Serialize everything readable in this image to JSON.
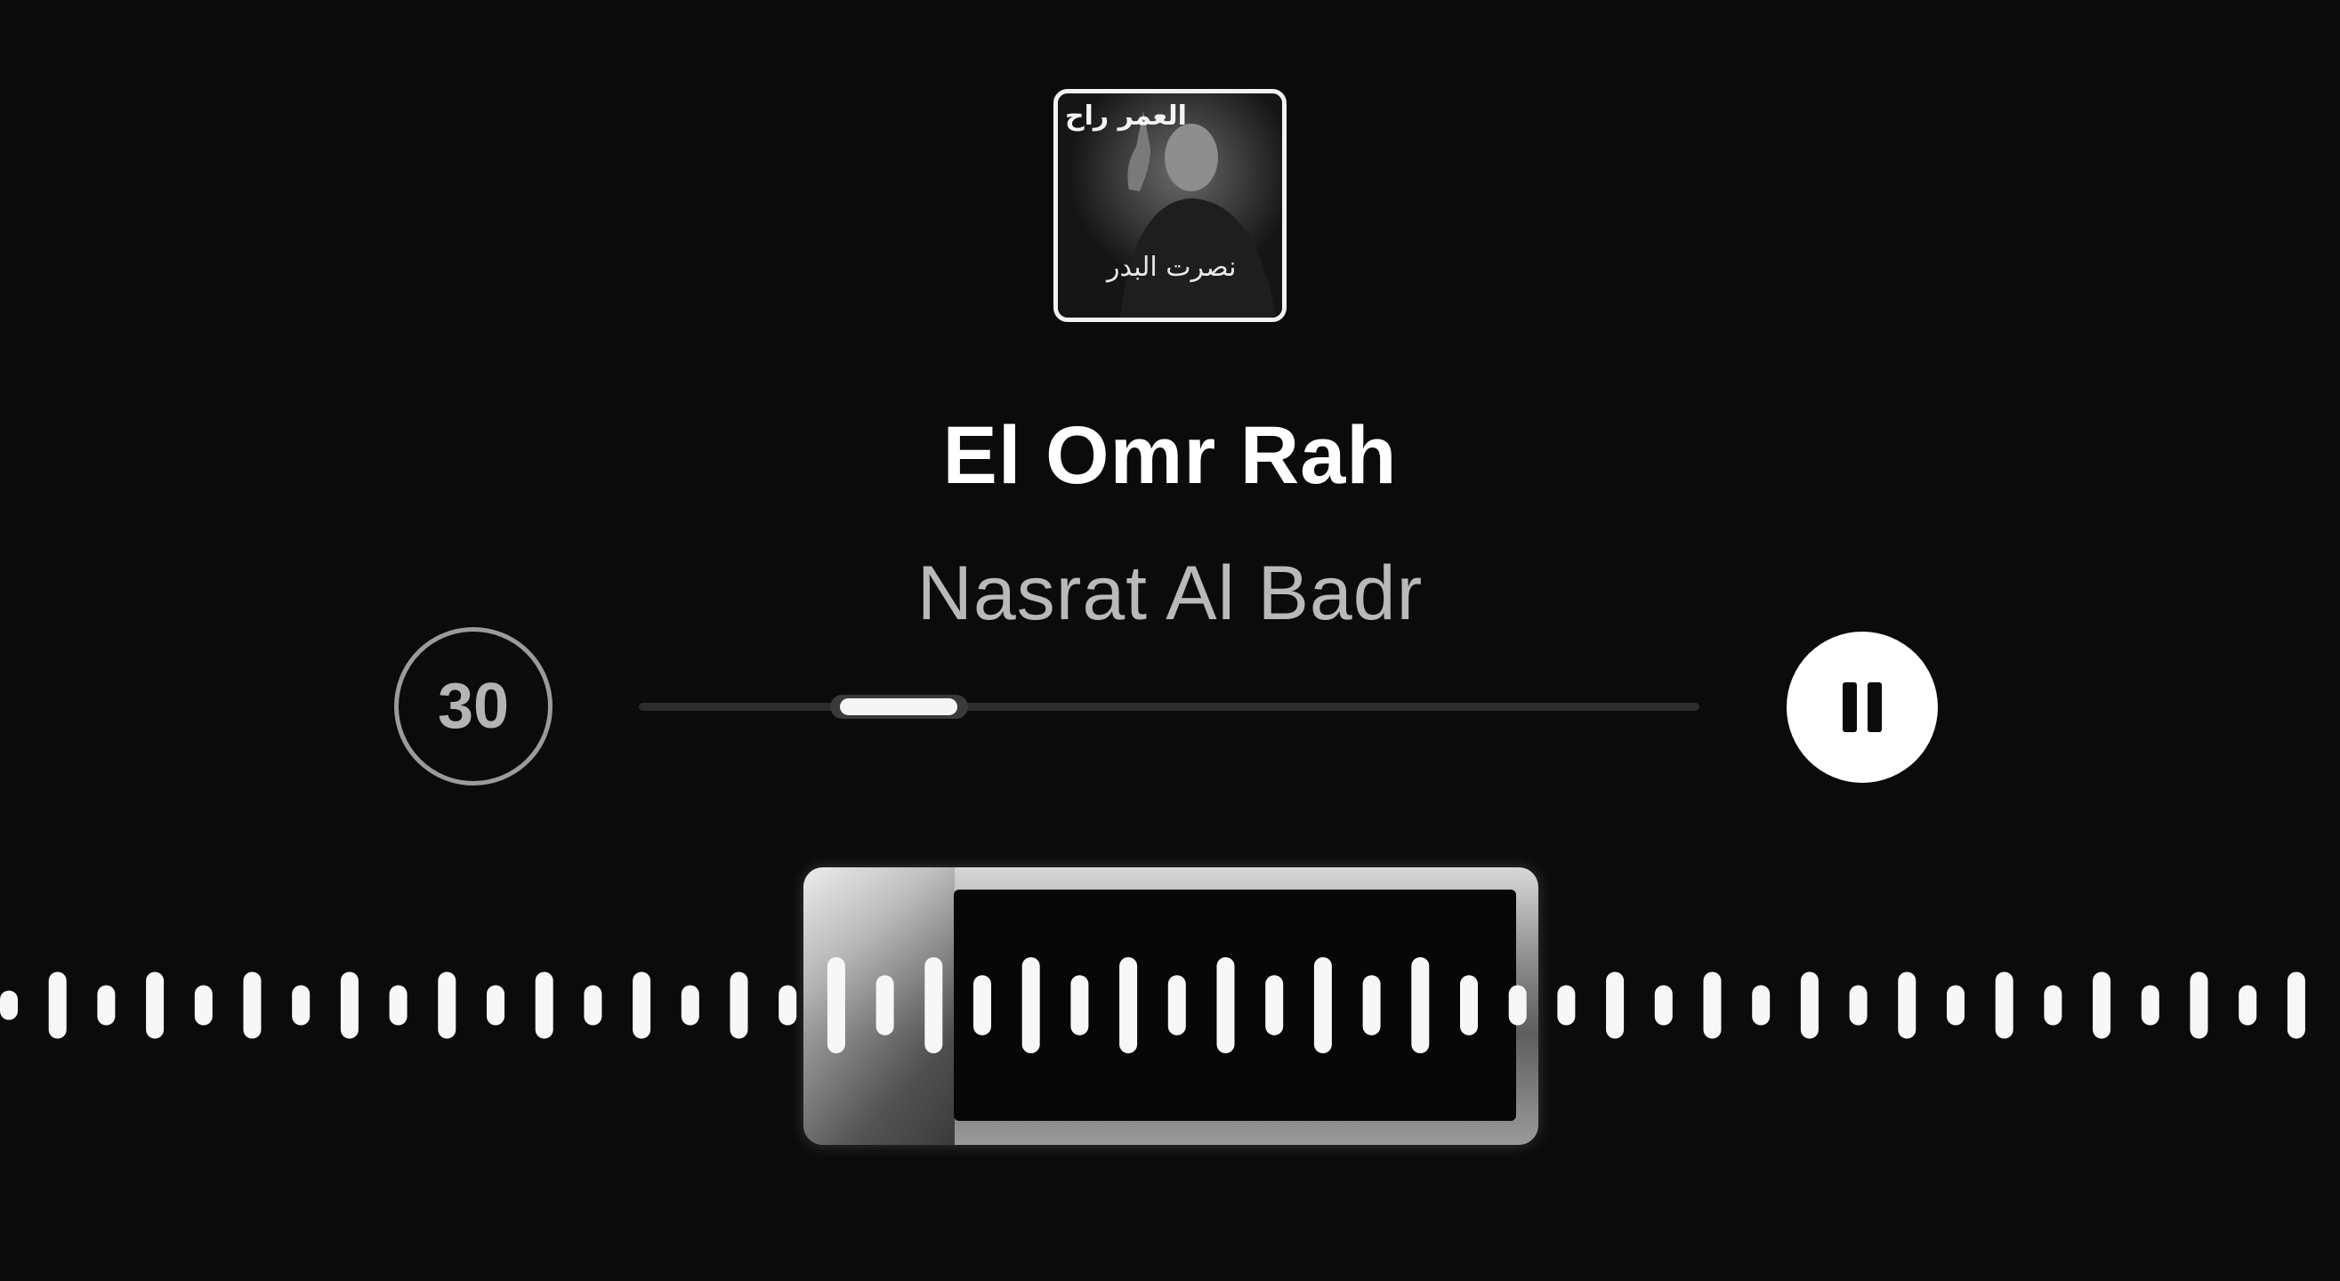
{
  "artwork": {
    "caption_top": "العمر راح",
    "caption_bottom": "نصرت البدر"
  },
  "track": {
    "title": "El Omr Rah",
    "artist": "Nasrat Al Badr"
  },
  "controls": {
    "skip_label": "30",
    "skip_icon": "skip-30-seconds-icon",
    "pause_icon": "pause-icon"
  },
  "progress": {
    "window_start": 0.18,
    "window_end": 0.31,
    "played_start": 0.19,
    "played_end": 0.3
  },
  "waveform": {
    "selection_start": 0.345,
    "selection_end": 0.657,
    "bars": [
      0.22,
      0.5,
      0.3,
      0.5,
      0.3,
      0.5,
      0.3,
      0.5,
      0.3,
      0.5,
      0.3,
      0.5,
      0.3,
      0.5,
      0.3,
      0.5,
      0.3,
      0.72,
      0.45,
      0.72,
      0.45,
      0.72,
      0.45,
      0.72,
      0.45,
      0.72,
      0.45,
      0.72,
      0.45,
      0.72,
      0.45,
      0.3,
      0.3,
      0.5,
      0.3,
      0.5,
      0.3,
      0.5,
      0.3,
      0.5,
      0.3,
      0.5,
      0.3,
      0.5,
      0.3,
      0.5,
      0.3,
      0.5
    ]
  },
  "colors": {
    "background": "#0b0b0b",
    "accent": "#ffffff",
    "secondary_text": "#b9b9b9"
  }
}
